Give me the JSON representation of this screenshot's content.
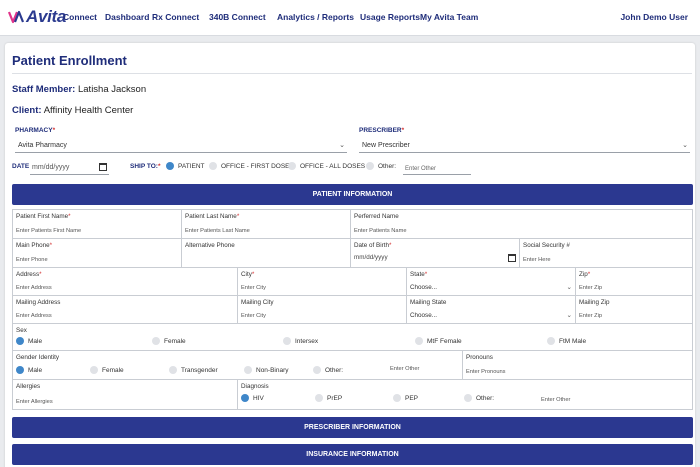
{
  "brand": {
    "logo_text": "Avita",
    "accent": "#2b3890"
  },
  "nav": {
    "items": [
      "Connect",
      "Dashboard",
      "Rx Connect",
      "340B Connect",
      "Analytics / Reports",
      "Usage Reports",
      "My Avita Team"
    ],
    "user": "John Demo User"
  },
  "page": {
    "title": "Patient Enrollment",
    "staff_label": "Staff Member:",
    "staff_value": "Latisha Jackson",
    "client_label": "Client:",
    "client_value": "Affinity Health Center"
  },
  "top_form": {
    "pharmacy_label": "PHARMACY",
    "pharmacy_value": "Avita Pharmacy",
    "prescriber_label": "PRESCRIBER",
    "prescriber_value": "New Prescriber",
    "date_label": "DATE",
    "date_placeholder": "mm/dd/yyyy",
    "ship_to_label": "SHIP TO:",
    "ship_options": [
      "PATIENT",
      "OFFICE - FIRST DOSE",
      "OFFICE - ALL DOSES",
      "Other:"
    ],
    "ship_selected": "PATIENT",
    "ship_other_placeholder": "Enter Other"
  },
  "sections": {
    "patient": "PATIENT INFORMATION",
    "prescriber": "PRESCRIBER INFORMATION",
    "insurance": "INSURANCE INFORMATION"
  },
  "patient": {
    "first_name": {
      "label": "Patient First Name",
      "placeholder": "Enter Patients First Name"
    },
    "last_name": {
      "label": "Patient Last Name",
      "placeholder": "Enter Patients Last Name"
    },
    "preferred_name": {
      "label": "Perferred Name",
      "placeholder": "Enter Patients Name"
    },
    "main_phone": {
      "label": "Main Phone",
      "placeholder": "Enter Phone"
    },
    "alt_phone": {
      "label": "Alternative Phone"
    },
    "dob": {
      "label": "Date of Birth",
      "placeholder": "mm/dd/yyyy"
    },
    "ssn": {
      "label": "Social Security #",
      "placeholder": "Enter Here"
    },
    "address": {
      "label": "Address",
      "placeholder": "Enter Address"
    },
    "city": {
      "label": "City",
      "placeholder": "Enter City"
    },
    "state": {
      "label": "State",
      "value": "Choose..."
    },
    "zip": {
      "label": "Zip",
      "placeholder": "Enter Zip"
    },
    "mail_address": {
      "label": "Mailing Address",
      "placeholder": "Enter Address"
    },
    "mail_city": {
      "label": "Mailing City",
      "placeholder": "Enter City"
    },
    "mail_state": {
      "label": "Mailing State",
      "value": "Choose..."
    },
    "mail_zip": {
      "label": "Mailing Zip",
      "placeholder": "Enter Zip"
    },
    "sex": {
      "label": "Sex",
      "options": [
        "Male",
        "Female",
        "Intersex",
        "MtF Female",
        "FtM Male"
      ],
      "selected": "Male"
    },
    "gender": {
      "label": "Gender Identity",
      "options": [
        "Male",
        "Female",
        "Transgender",
        "Non-Binary",
        "Other:"
      ],
      "selected": "Male",
      "other_placeholder": "Enter Other"
    },
    "pronouns": {
      "label": "Pronouns",
      "placeholder": "Enter Pronouns"
    },
    "allergies": {
      "label": "Allergies",
      "placeholder": "Enter Allergies"
    },
    "diagnosis": {
      "label": "Diagnosis",
      "options": [
        "HIV",
        "PrEP",
        "PEP",
        "Other:"
      ],
      "selected": "HIV",
      "other_placeholder": "Enter Other"
    }
  }
}
